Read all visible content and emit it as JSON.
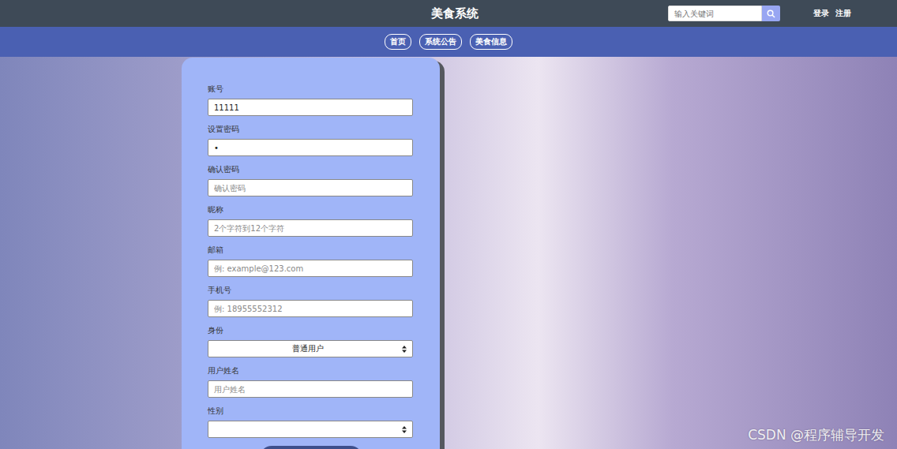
{
  "header": {
    "title": "美食系统",
    "search": {
      "placeholder": "输入关键词"
    },
    "links": [
      "登录",
      "注册"
    ]
  },
  "nav": [
    {
      "label": "首页"
    },
    {
      "label": "系统公告"
    },
    {
      "label": "美食信息"
    }
  ],
  "form": {
    "fields": [
      {
        "label": "账号",
        "kind": "input",
        "value": "11111",
        "placeholder": ""
      },
      {
        "label": "设置密码",
        "kind": "input",
        "value": "•",
        "placeholder": ""
      },
      {
        "label": "确认密码",
        "kind": "input",
        "value": "",
        "placeholder": "确认密码"
      },
      {
        "label": "昵称",
        "kind": "input",
        "value": "",
        "placeholder": "2个字符到12个字符"
      },
      {
        "label": "邮箱",
        "kind": "input",
        "value": "",
        "placeholder": "例: example@123.com"
      },
      {
        "label": "手机号",
        "kind": "input",
        "value": "",
        "placeholder": "例: 18955552312"
      },
      {
        "label": "身份",
        "kind": "select",
        "value": "普通用户",
        "placeholder": ""
      },
      {
        "label": "用户姓名",
        "kind": "input",
        "value": "",
        "placeholder": "用户姓名"
      },
      {
        "label": "性别",
        "kind": "select",
        "value": "",
        "placeholder": ""
      }
    ]
  },
  "watermark": "CSDN @程序辅导开发"
}
